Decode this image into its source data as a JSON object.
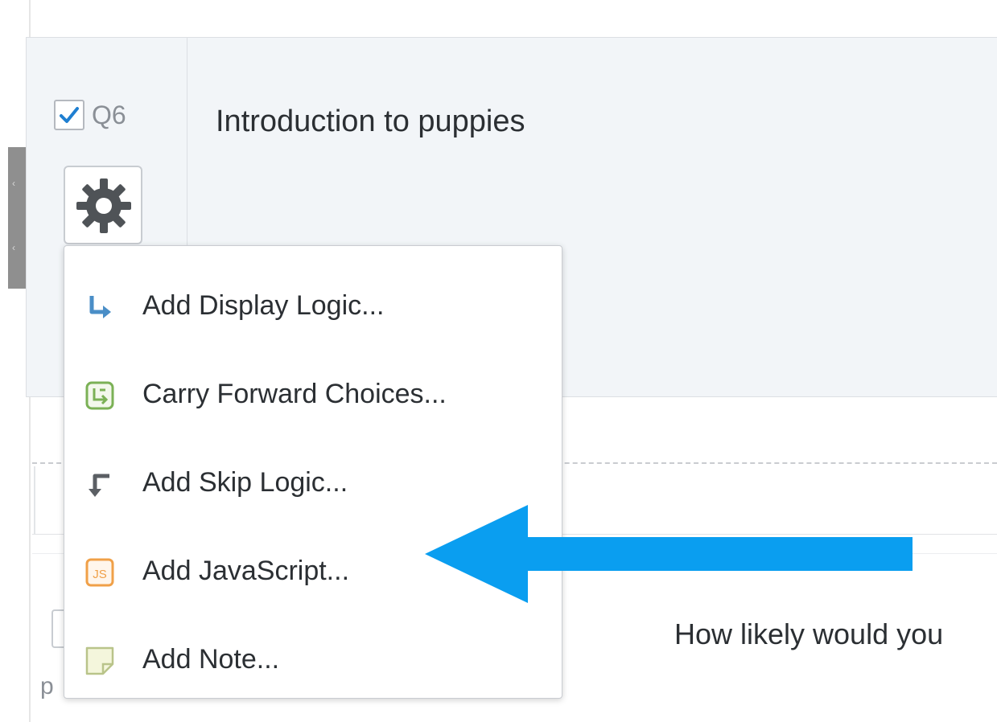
{
  "question": {
    "number": "Q6",
    "title": "Introduction to puppies",
    "checked": true
  },
  "menu": {
    "items": [
      {
        "label": "Add Display Logic...",
        "icon": "display-logic-icon",
        "color": "#4a8ec7"
      },
      {
        "label": "Carry Forward Choices...",
        "icon": "carry-forward-icon",
        "color": "#7bb156"
      },
      {
        "label": "Add Skip Logic...",
        "icon": "skip-logic-icon",
        "color": "#5b5f64"
      },
      {
        "label": "Add JavaScript...",
        "icon": "javascript-icon",
        "color": "#f0a048"
      },
      {
        "label": "Add Note...",
        "icon": "note-icon",
        "color": "#b9c48a"
      }
    ]
  },
  "next_question": {
    "text": "How likely would you"
  },
  "behind_menu": {
    "letter": "p"
  },
  "colors": {
    "arrow": "#0a9ef0",
    "checkmark": "#1f7fd1",
    "question_bg": "#f2f5f8"
  }
}
